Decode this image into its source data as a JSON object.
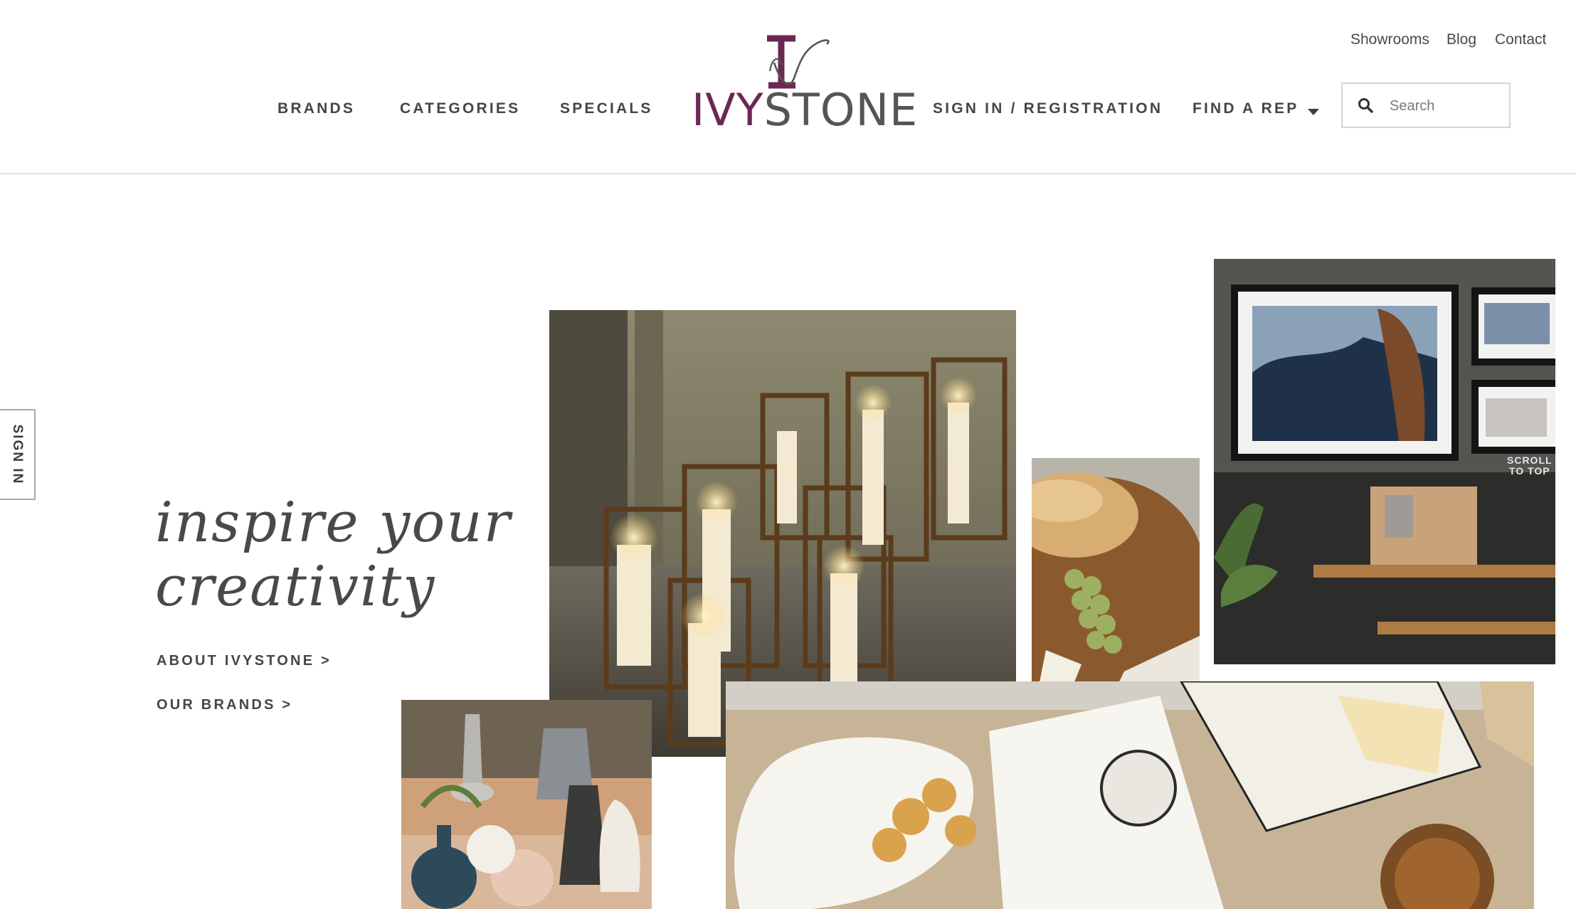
{
  "header": {
    "utility_links": [
      "Showrooms",
      "Blog",
      "Contact"
    ],
    "nav_left": [
      "BRANDS",
      "CATEGORIES",
      "SPECIALS"
    ],
    "nav_right": [
      "SIGN IN / REGISTRATION",
      "FIND A REP"
    ],
    "logo": {
      "part1": "IVY",
      "part2": "STONE"
    },
    "search": {
      "placeholder": "Search",
      "value": ""
    }
  },
  "side_tab": {
    "label": "SIGN IN"
  },
  "hero": {
    "headline_line1": "inspire your",
    "headline_line2": "creativity",
    "links": [
      "ABOUT IVYSTONE >",
      "OUR BRANDS >"
    ]
  },
  "scroll_to_top": {
    "line1": "SCROLL",
    "line2": "TO TOP"
  },
  "colors": {
    "brand_plum": "#6c2753",
    "text_dark": "#4a4444",
    "divider": "#e3e3e3"
  },
  "icons": [
    "search-icon",
    "chevron-down-icon"
  ]
}
